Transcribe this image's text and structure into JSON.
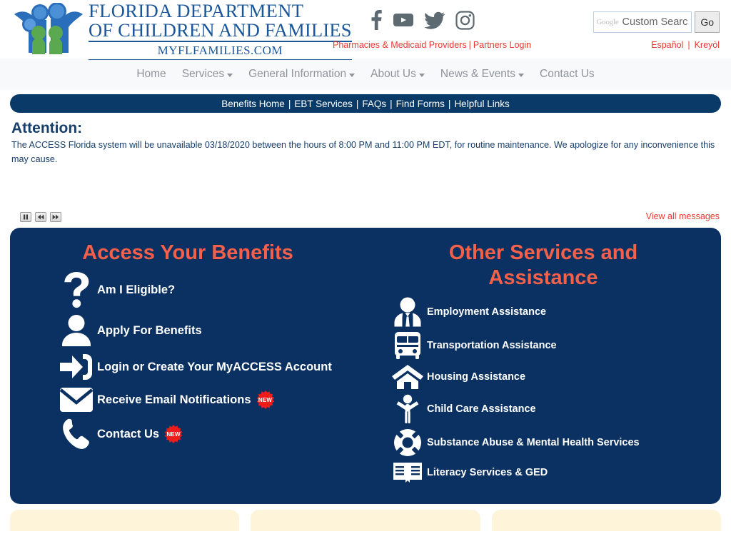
{
  "header": {
    "logo": {
      "line1": "FLORIDA DEPARTMENT",
      "line2": "OF CHILDREN AND FAMILIES",
      "line3": "MYFLFAMILIES.COM",
      "alt": "Florida Department of Children and Families logo"
    },
    "social": [
      {
        "name": "facebook-icon",
        "label": "Facebook"
      },
      {
        "name": "youtube-icon",
        "label": "YouTube"
      },
      {
        "name": "twitter-icon",
        "label": "Twitter"
      },
      {
        "name": "instagram-icon",
        "label": "Instagram"
      }
    ],
    "red_links": {
      "pharmacies": "Pharmacies & Medicaid Providers",
      "separator": "|",
      "partners": "Partners Login"
    },
    "search": {
      "branding": "Google",
      "value": "Custom Search",
      "placeholder": "Custom Search",
      "button": "Go"
    },
    "languages": {
      "spanish": "Español",
      "separator": "|",
      "creole": "Kreyòl"
    }
  },
  "mainnav": {
    "items": [
      {
        "label": "Home",
        "caret": false
      },
      {
        "label": "Services",
        "caret": true
      },
      {
        "label": "General Information",
        "caret": true
      },
      {
        "label": "About Us",
        "caret": true
      },
      {
        "label": "News & Events",
        "caret": true
      },
      {
        "label": "Contact Us",
        "caret": false
      }
    ]
  },
  "subnav": {
    "items": [
      "Benefits Home",
      "EBT Services",
      "FAQs",
      "Find Forms",
      "Helpful Links"
    ],
    "separator": "|"
  },
  "attention": {
    "heading": "Attention:",
    "body": "The ACCESS Florida system will be unavailable 03/18/2020 between the hours of 8:00 PM and 11:00 PM EDT, for routine maintenance. We apologize for any inconvenience this may cause."
  },
  "carousel": {
    "controls": [
      {
        "name": "pause-button",
        "label": "Pause"
      },
      {
        "name": "previous-button",
        "label": "Previous"
      },
      {
        "name": "next-button",
        "label": "Next"
      }
    ],
    "view_all": "View all messages"
  },
  "panel": {
    "left": {
      "title": "Access Your Benefits",
      "items": [
        {
          "icon": "question-mark-icon",
          "label": "Am I Eligible?",
          "badge": null
        },
        {
          "icon": "person-icon",
          "label": "Apply For Benefits",
          "badge": null
        },
        {
          "icon": "login-arrow-icon",
          "label": "Login or Create Your MyACCESS Account",
          "badge": null
        },
        {
          "icon": "envelope-icon",
          "label": "Receive Email Notifications",
          "badge": "NEW"
        },
        {
          "icon": "phone-icon",
          "label": "Contact Us",
          "badge": "NEW"
        }
      ]
    },
    "right": {
      "title": "Other Services and Assistance",
      "items": [
        {
          "icon": "business-person-icon",
          "label": "Employment Assistance"
        },
        {
          "icon": "bus-icon",
          "label": "Transportation Assistance"
        },
        {
          "icon": "house-icon",
          "label": "Housing Assistance"
        },
        {
          "icon": "child-icon",
          "label": "Child Care Assistance"
        },
        {
          "icon": "life-ring-icon",
          "label": "Substance Abuse & Mental Health Services"
        },
        {
          "icon": "open-book-icon",
          "label": "Literacy Services & GED"
        }
      ]
    }
  },
  "bottom_cards": [
    {
      "name": "bottom-card-1"
    },
    {
      "name": "bottom-card-2"
    },
    {
      "name": "bottom-card-3"
    }
  ],
  "colors": {
    "panel_blue": "#0a3161",
    "subnav_blue": "#0a3a68",
    "heading_coral": "#f4604a",
    "link_red": "#e8392f",
    "logo_blue": "#1a5699",
    "logo_green": "#5aa84f",
    "badge_red": "#f01b1b",
    "card_cream": "#fdf4da"
  }
}
